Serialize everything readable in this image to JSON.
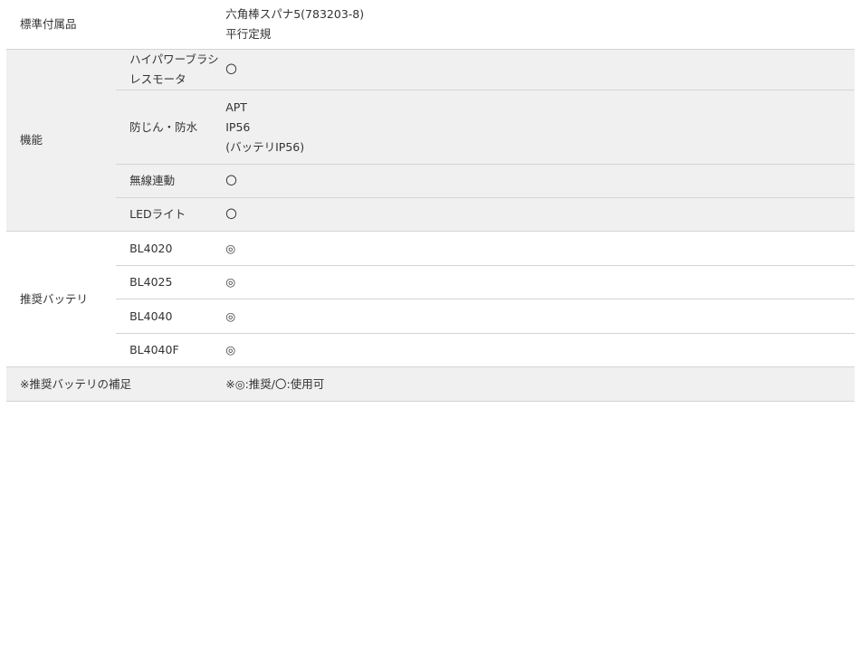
{
  "rows": {
    "accessories": {
      "label": "標準付属品",
      "values": [
        "六角棒スパナ5(783203-8)",
        "平行定規"
      ]
    },
    "function": {
      "label": "機能",
      "items": [
        {
          "name": "ハイパワーブラシレスモータ",
          "values": [
            "〇"
          ]
        },
        {
          "name": "防じん・防水",
          "values": [
            "APT",
            "IP56",
            "(バッテリIP56)"
          ]
        },
        {
          "name": "無線連動",
          "values": [
            "〇"
          ]
        },
        {
          "name": "LEDライト",
          "values": [
            "〇"
          ]
        }
      ]
    },
    "battery": {
      "label": "推奨バッテリ",
      "items": [
        {
          "name": "BL4020",
          "value": "◎"
        },
        {
          "name": "BL4025",
          "value": "◎"
        },
        {
          "name": "BL4040",
          "value": "◎"
        },
        {
          "name": "BL4040F",
          "value": "◎"
        }
      ]
    },
    "note": {
      "label": "※推奨バッテリの補足",
      "value": "※◎:推奨/〇:使用可"
    }
  }
}
